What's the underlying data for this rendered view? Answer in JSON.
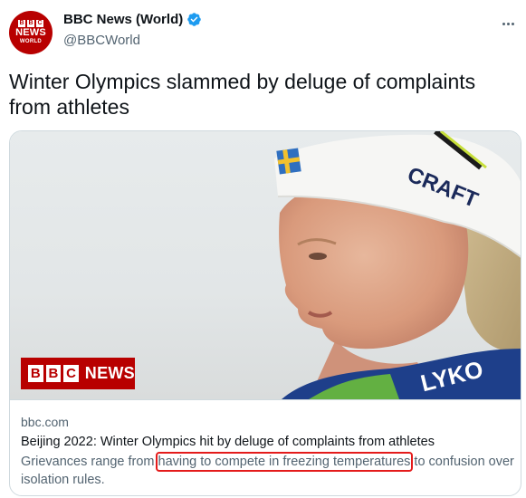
{
  "account": {
    "display_name": "BBC News (World)",
    "handle": "@BBCWorld",
    "avatar_line1": [
      "B",
      "B",
      "C"
    ],
    "avatar_line2": "NEWS",
    "avatar_line3": "WORLD",
    "verified_color": "#1d9bf0"
  },
  "tweet": {
    "text": "Winter Olympics slammed by deluge of complaints from athletes"
  },
  "card": {
    "logo_letters": [
      "B",
      "B",
      "C"
    ],
    "logo_word": "NEWS",
    "domain": "bbc.com",
    "title": "Beijing 2022: Winter Olympics hit by deluge of complaints from athletes",
    "desc_before": "Grievances range from ",
    "desc_highlight": "having to compete in freezing temperatures",
    "desc_after": " to confusion over isolation rules.",
    "highlight_color": "#e41b1b"
  },
  "colors": {
    "brand": "#b80000",
    "text_primary": "#0f1419",
    "text_secondary": "#536471"
  }
}
